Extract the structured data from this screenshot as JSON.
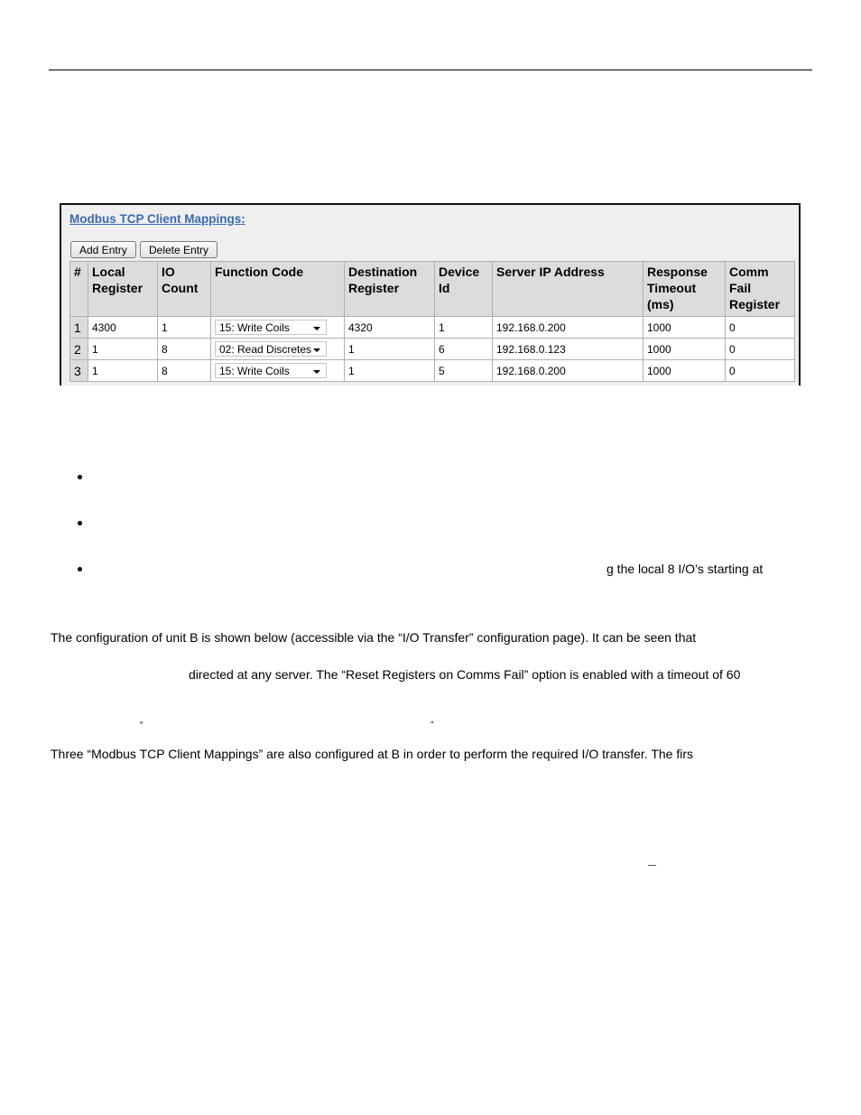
{
  "panel": {
    "title": "Modbus TCP Client Mappings:",
    "buttons": {
      "add": "Add Entry",
      "delete": "Delete Entry"
    },
    "columns": [
      "#",
      "Local Register",
      "IO Count",
      "Function Code",
      "Destination Register",
      "Device Id",
      "Server IP Address",
      "Response Timeout (ms)",
      "Comm Fail Register"
    ],
    "rows": [
      {
        "num": "1",
        "local_register": "4300",
        "io_count": "1",
        "function_code": "15: Write Coils",
        "destination_register": "4320",
        "device_id": "1",
        "server_ip": "192.168.0.200",
        "response_timeout": "1000",
        "comm_fail_register": "0"
      },
      {
        "num": "2",
        "local_register": "1",
        "io_count": "8",
        "function_code": "02: Read Discretes",
        "destination_register": "1",
        "device_id": "6",
        "server_ip": "192.168.0.123",
        "response_timeout": "1000",
        "comm_fail_register": "0"
      },
      {
        "num": "3",
        "local_register": "1",
        "io_count": "8",
        "function_code": "15: Write Coils",
        "destination_register": "1",
        "device_id": "5",
        "server_ip": "192.168.0.200",
        "response_timeout": "1000",
        "comm_fail_register": "0"
      }
    ]
  },
  "body_text": {
    "bullet3_fragment": "g the local 8 I/O’s starting at",
    "para1_line1": "The configuration of unit B is shown below (accessible via the “I/O Transfer” configuration page). It can be seen that",
    "para1_line2": "directed at any server. The “Reset Registers on Comms Fail” option is enabled with a timeout of 60",
    "open_quote": "“",
    "close_quote": "”",
    "para2_line1": "Three “Modbus TCP Client Mappings” are also configured at B in order to perform the required I/O transfer. The firs"
  }
}
